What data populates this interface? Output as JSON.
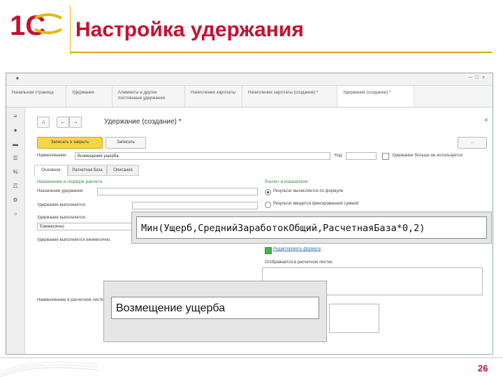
{
  "slide": {
    "logo_text": "1С",
    "title": "Настройка удержания",
    "page_number": "26",
    "brand_color": "#c8102e"
  },
  "tabs": [
    {
      "label": "Начальная страница"
    },
    {
      "label": "Удержания"
    },
    {
      "label": "Алименты и другие постоянные удержания"
    },
    {
      "label": "Начисление зарплаты"
    },
    {
      "label": "Начисление зарплаты (создание) *"
    },
    {
      "label": "Удержание (создание) *"
    }
  ],
  "form": {
    "title": "Удержание (создание) *",
    "save_close_label": "Записать и закрыть",
    "save_label": "Записать",
    "name_label": "Наименование:",
    "name_value": "Возмещение ущерба",
    "code_label": "Код:",
    "checkbox_label": "Удержание больше не используется",
    "inner_tabs": [
      "Основное",
      "Расчетная база",
      "Описание"
    ],
    "group_purpose": "Назначение и порядок расчета",
    "purpose_label": "Назначение удержания:",
    "purpose_value": "",
    "method_label": "Удержание выполняется:",
    "method_value": "",
    "base_label": "Удержание выполняется:",
    "base_value": "Ежемесячно",
    "period_label": "Удержание выполняется ежемесячно:",
    "group_result": "Расчет и показатели",
    "radio_1": "Результат вычисляется по формуле",
    "radio_2": "Результат вводится фиксированной суммой",
    "edit_formula": "Редактировать формулу",
    "indicator_label": "Отображается в расчетном листке:",
    "description_label": "Наименование в расчетном листке:",
    "formula": "Мин(Ущерб,СреднийЗаработокОбщий,РасчетнаяБаза*0,2)",
    "payslip_name": "Возмещение ущерба"
  }
}
